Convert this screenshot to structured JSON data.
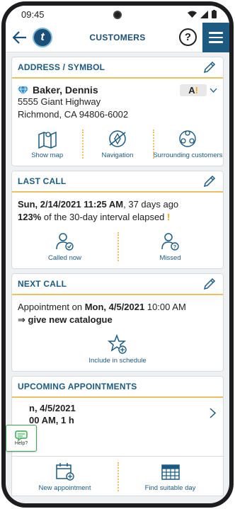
{
  "status": {
    "time": "09:45"
  },
  "appbar": {
    "title": "CUSTOMERS",
    "logo_letter": "t",
    "help": "?"
  },
  "address": {
    "header": "ADDRESS / SYMBOL",
    "name": "Baker, Dennis",
    "street": "5555 Giant Highway",
    "city": "Richmond, CA 94806-6002",
    "rating": "A",
    "rating_mark": "!",
    "actions": [
      "Show map",
      "Navigation",
      "Surrounding customers"
    ]
  },
  "last_call": {
    "header": "LAST CALL",
    "date": "Sun, 2/14/2021 11:25 AM",
    "ago": ", 37 days ago",
    "percent": "123%",
    "interval": " of the 30-day interval elapsed ",
    "mark": "!",
    "actions": [
      "Called now",
      "Missed"
    ]
  },
  "next_call": {
    "header": "NEXT CALL",
    "prefix": "Appointment on ",
    "date": "Mon, 4/5/2021",
    "time": " 10:00 AM",
    "arrow": "⇒ ",
    "task": "give new catalogue",
    "action": "Include in schedule"
  },
  "upcoming": {
    "header": "UPCOMING APPOINTMENTS",
    "line1": "n, 4/5/2021",
    "line2": "00 AM, 1 h",
    "actions": [
      "New appointment",
      "Find suitable day"
    ]
  },
  "help_fab": {
    "label": "Help?"
  },
  "colors": {
    "accent": "#1c5a82",
    "divider": "#f0c060",
    "warning": "#f0a500"
  }
}
